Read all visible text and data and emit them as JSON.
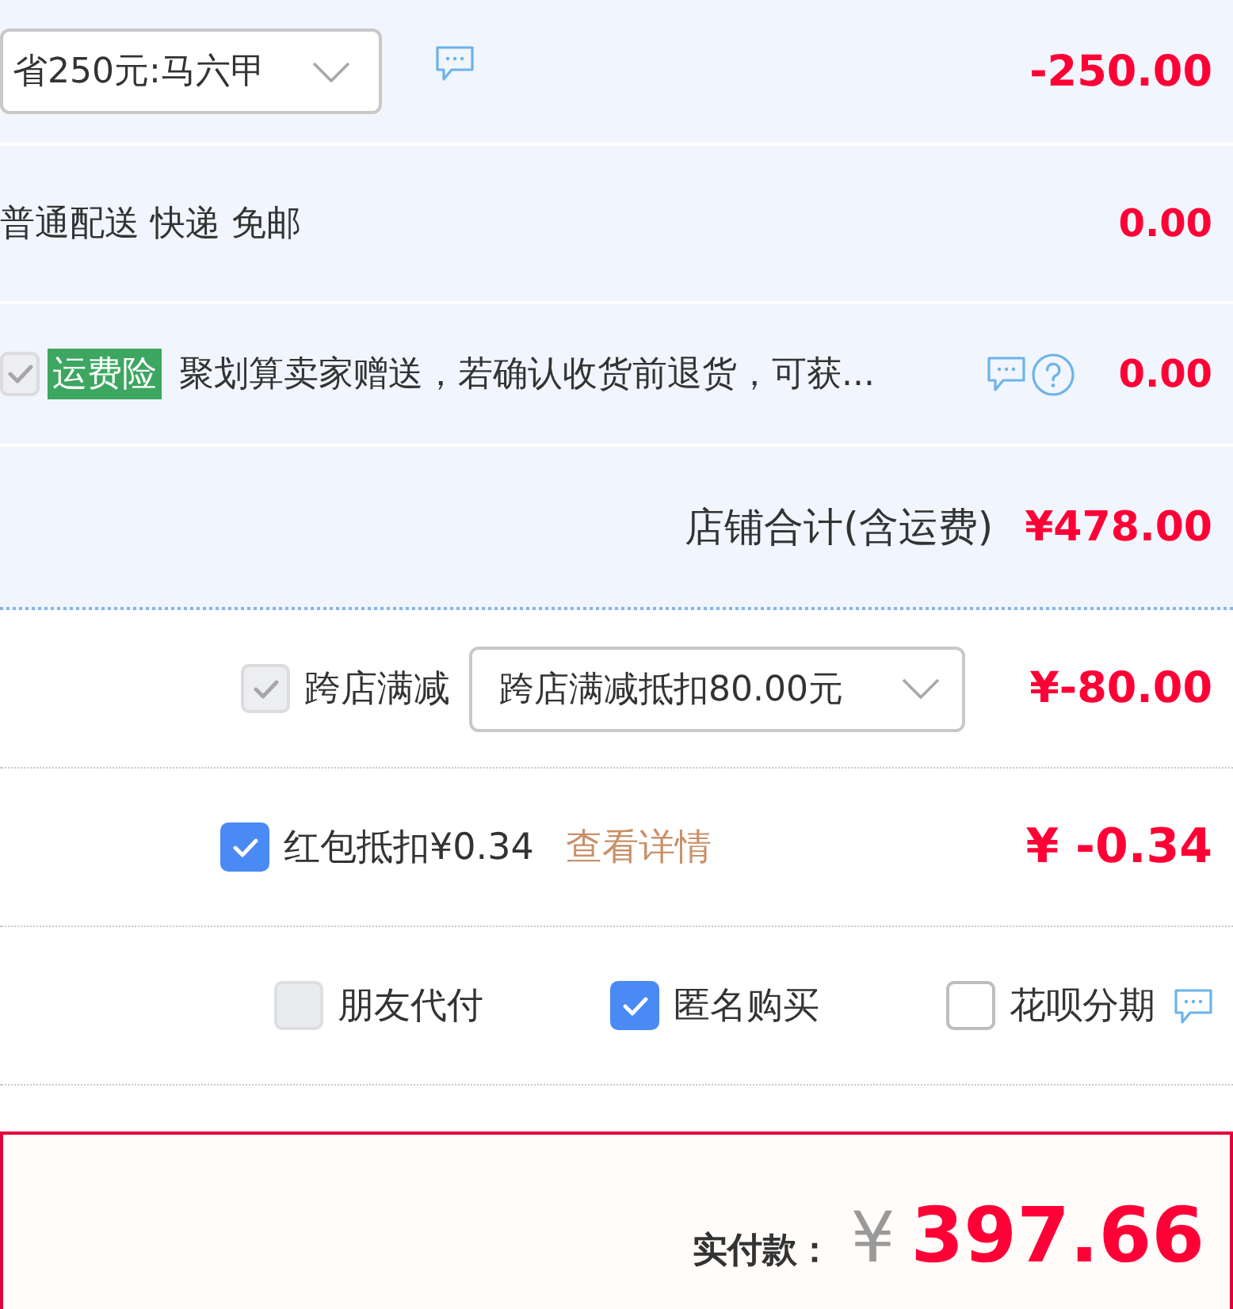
{
  "shop_section": {
    "rows": [
      {
        "kind": "promotion",
        "select": {
          "value": "省250元:马六甲"
        },
        "amount": "-250.00"
      },
      {
        "kind": "delivery",
        "text": "普通配送 快递 免邮",
        "amount": "0.00"
      },
      {
        "kind": "insurance",
        "checkbox": {
          "checked": true,
          "disabled": true
        },
        "tag": "运费险",
        "text": "聚划算卖家赠送，若确认收货前退货，可获...",
        "amount": "0.00"
      },
      {
        "kind": "subtotal",
        "label": "店铺合计(含运费)",
        "amount": "¥478.00"
      }
    ]
  },
  "order_section": {
    "rows": [
      {
        "kind": "discount",
        "checkbox": {
          "checked": true,
          "disabled": true
        },
        "label": "跨店满减",
        "select": {
          "value": "跨店满减抵扣80.00元"
        },
        "amount": "¥-80.00"
      },
      {
        "kind": "red_packet",
        "checkbox": {
          "checked": true,
          "disabled": false
        },
        "label": "红包抵扣¥0.34",
        "link": "查看详情",
        "amount": "¥ -0.34"
      },
      {
        "kind": "options",
        "options": [
          {
            "label": "朋友代付",
            "checked": false,
            "disabled": true
          },
          {
            "label": "匿名购买",
            "checked": true,
            "disabled": false
          },
          {
            "label": "花呗分期",
            "checked": false,
            "disabled": false
          }
        ]
      }
    ]
  },
  "total": {
    "label": "实付款：",
    "currency": "¥",
    "amount": "397.66"
  }
}
